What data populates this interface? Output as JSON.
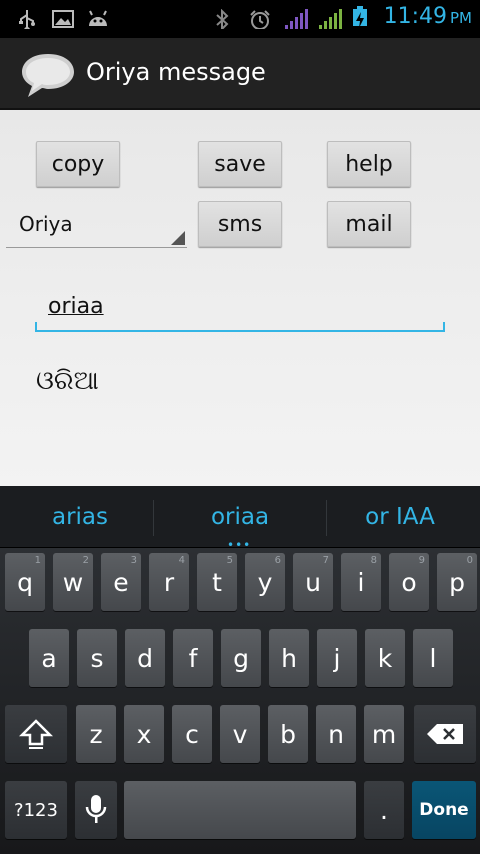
{
  "status_bar": {
    "time": "11:49",
    "ampm": "PM",
    "icons": [
      "usb-icon",
      "picture-icon",
      "android-icon",
      "bluetooth-icon",
      "alarm-icon",
      "signal-icon",
      "signal-icon",
      "battery-charging-icon"
    ]
  },
  "action_bar": {
    "title": "Oriya message"
  },
  "buttons": {
    "copy": "copy",
    "save": "save",
    "help": "help",
    "sms": "sms",
    "mail": "mail"
  },
  "language_spinner": {
    "selected": "Oriya"
  },
  "input": {
    "value": "oriaa"
  },
  "output": {
    "text": "ଓରିଆ"
  },
  "suggestions": [
    "arias",
    "oriaa",
    "or IAA"
  ],
  "suggestions_more": "•••",
  "keyboard": {
    "row1": [
      {
        "l": "q",
        "h": "1"
      },
      {
        "l": "w",
        "h": "2"
      },
      {
        "l": "e",
        "h": "3"
      },
      {
        "l": "r",
        "h": "4"
      },
      {
        "l": "t",
        "h": "5"
      },
      {
        "l": "y",
        "h": "6"
      },
      {
        "l": "u",
        "h": "7"
      },
      {
        "l": "i",
        "h": "8"
      },
      {
        "l": "o",
        "h": "9"
      },
      {
        "l": "p",
        "h": "0"
      }
    ],
    "row2": [
      "a",
      "s",
      "d",
      "f",
      "g",
      "h",
      "j",
      "k",
      "l"
    ],
    "row3": [
      "z",
      "x",
      "c",
      "v",
      "b",
      "n",
      "m"
    ],
    "symbols_label": "?123",
    "period_label": ".",
    "done_label": "Done"
  },
  "colors": {
    "accent": "#33b5e5",
    "done_key": "#0a5676"
  }
}
